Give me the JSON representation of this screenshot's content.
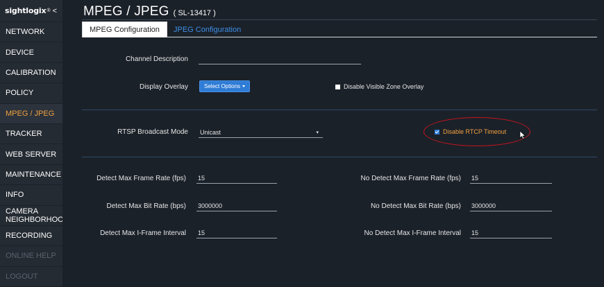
{
  "brand": {
    "name": "sightlogix",
    "mark": "®",
    "collapse": "<"
  },
  "sidebar": {
    "items": [
      {
        "label": "NETWORK",
        "state": "normal"
      },
      {
        "label": "DEVICE",
        "state": "normal"
      },
      {
        "label": "CALIBRATION",
        "state": "normal"
      },
      {
        "label": "POLICY",
        "state": "normal"
      },
      {
        "label": "MPEG / JPEG",
        "state": "active"
      },
      {
        "label": "TRACKER",
        "state": "normal"
      },
      {
        "label": "WEB SERVER",
        "state": "normal"
      },
      {
        "label": "MAINTENANCE",
        "state": "normal"
      },
      {
        "label": "INFO",
        "state": "normal"
      },
      {
        "label": "CAMERA NEIGHBORHOOD",
        "state": "normal"
      },
      {
        "label": "RECORDING",
        "state": "normal"
      },
      {
        "label": "ONLINE HELP",
        "state": "disabled"
      },
      {
        "label": "LOGOUT",
        "state": "disabled"
      }
    ]
  },
  "page": {
    "title": "MPEG / JPEG",
    "subtitle": "( SL-13417 )"
  },
  "tabs": [
    {
      "label": "MPEG Configuration",
      "active": true
    },
    {
      "label": "JPEG Configuration",
      "active": false
    }
  ],
  "form": {
    "channel_description": {
      "label": "Channel Description",
      "value": ""
    },
    "display_overlay": {
      "label": "Display Overlay",
      "button_label": "Select Options"
    },
    "disable_visible_zone_overlay": {
      "label": "Disable Visible Zone Overlay",
      "checked": false
    },
    "rtsp_broadcast_mode": {
      "label": "RTSP Broadcast Mode",
      "value": "Unicast",
      "caret": "▾"
    },
    "disable_rtcp_timeout": {
      "label": "Disable RTCP Timeout",
      "checked": true
    },
    "detect_max_frame_rate": {
      "label": "Detect Max Frame Rate (fps)",
      "value": "15"
    },
    "no_detect_max_frame_rate": {
      "label": "No Detect Max Frame Rate (fps)",
      "value": "15"
    },
    "detect_max_bit_rate": {
      "label": "Detect Max Bit Rate (bps)",
      "value": "3000000"
    },
    "no_detect_max_bit_rate": {
      "label": "No Detect Max Bit Rate (bps)",
      "value": "3000000"
    },
    "detect_max_iframe_interval": {
      "label": "Detect Max I-Frame Interval",
      "value": "15"
    },
    "no_detect_max_iframe_interval": {
      "label": "No Detect Max I-Frame Interval",
      "value": "15"
    }
  },
  "colors": {
    "accent": "#f0a040",
    "link": "#3d8ee6",
    "button": "#2f7cd6",
    "highlight": "#c8141e",
    "background": "#1b2129",
    "sidebar": "#252b33"
  },
  "icons": {
    "cursor": "mouse-pointer-icon",
    "checkbox": "checkbox-icon",
    "caret": "caret-down-icon"
  }
}
